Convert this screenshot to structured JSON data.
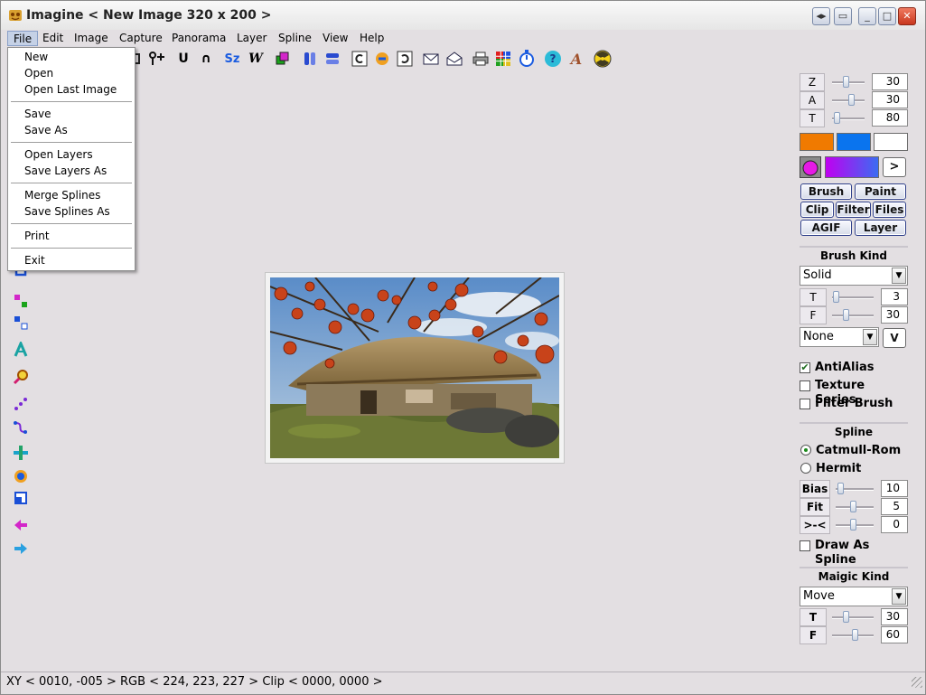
{
  "window": {
    "title": "Imagine < New Image 320 x 200 >"
  },
  "menubar": [
    "File",
    "Edit",
    "Image",
    "Capture",
    "Panorama",
    "Layer",
    "Spline",
    "View",
    "Help"
  ],
  "file_menu": {
    "items": [
      "New",
      "Open",
      "Open Last Image",
      "Save",
      "Save As",
      "Open Layers",
      "Save Layers As",
      "Merge Splines",
      "Save Splines As",
      "Print",
      "Exit"
    ]
  },
  "toolbar": {
    "tool_u": "U",
    "tool_cap": "∩",
    "tool_sz": "Sz",
    "tool_w": "W",
    "tool_a": "A",
    "tool_help": "?"
  },
  "right_panel": {
    "zat": [
      {
        "label": "Z",
        "value": "30",
        "level": 0.3
      },
      {
        "label": "A",
        "value": "30",
        "level": 0.5
      },
      {
        "label": "T",
        "value": "80",
        "level": 0.1
      }
    ],
    "colors": {
      "primary": "#f07a00",
      "secondary": "#0a74ee",
      "background": "#ffffff",
      "gradient_start": "#c000f0",
      "gradient_end": "#3b6cf2",
      "circle": "#e61ae6"
    },
    "arrow_btn": ">",
    "buttons_row1": [
      "Brush",
      "Paint"
    ],
    "buttons_row2": [
      "Clip",
      "Filter",
      "Files"
    ],
    "buttons_row3": [
      "AGIF",
      "Layer"
    ],
    "brush_kind": {
      "heading": "Brush Kind",
      "select_value": "Solid",
      "sliders": [
        {
          "label": "T",
          "value": "3",
          "level": 0.05
        },
        {
          "label": "F",
          "value": "30",
          "level": 0.3
        }
      ],
      "select2_value": "None",
      "v_btn": "V",
      "checks": [
        {
          "label": "AntiAlias",
          "checked": true
        },
        {
          "label": "Texture Series",
          "checked": false
        },
        {
          "label": "Filter Brush",
          "checked": false
        }
      ]
    },
    "spline": {
      "heading": "Spline",
      "radios": [
        {
          "label": "Catmull-Rom",
          "checked": true
        },
        {
          "label": "Hermit",
          "checked": false
        }
      ],
      "sliders": [
        {
          "label": "Bias",
          "value": "10",
          "level": 0.1
        },
        {
          "label": "Fit",
          "value": "5",
          "level": 0.5
        },
        {
          "label": ">-<",
          "value": "0",
          "level": 0.5
        }
      ],
      "draw_as_spline": "Draw As Spline"
    },
    "magic_kind": {
      "heading": "Maigic Kind",
      "select_value": "Move",
      "sliders": [
        {
          "label": "T",
          "value": "30",
          "level": 0.3
        },
        {
          "label": "F",
          "value": "60",
          "level": 0.6
        }
      ]
    }
  },
  "status": {
    "text": "XY < 0010, -005 > RGB < 224, 223, 227 > Clip < 0000, 0000 >"
  }
}
